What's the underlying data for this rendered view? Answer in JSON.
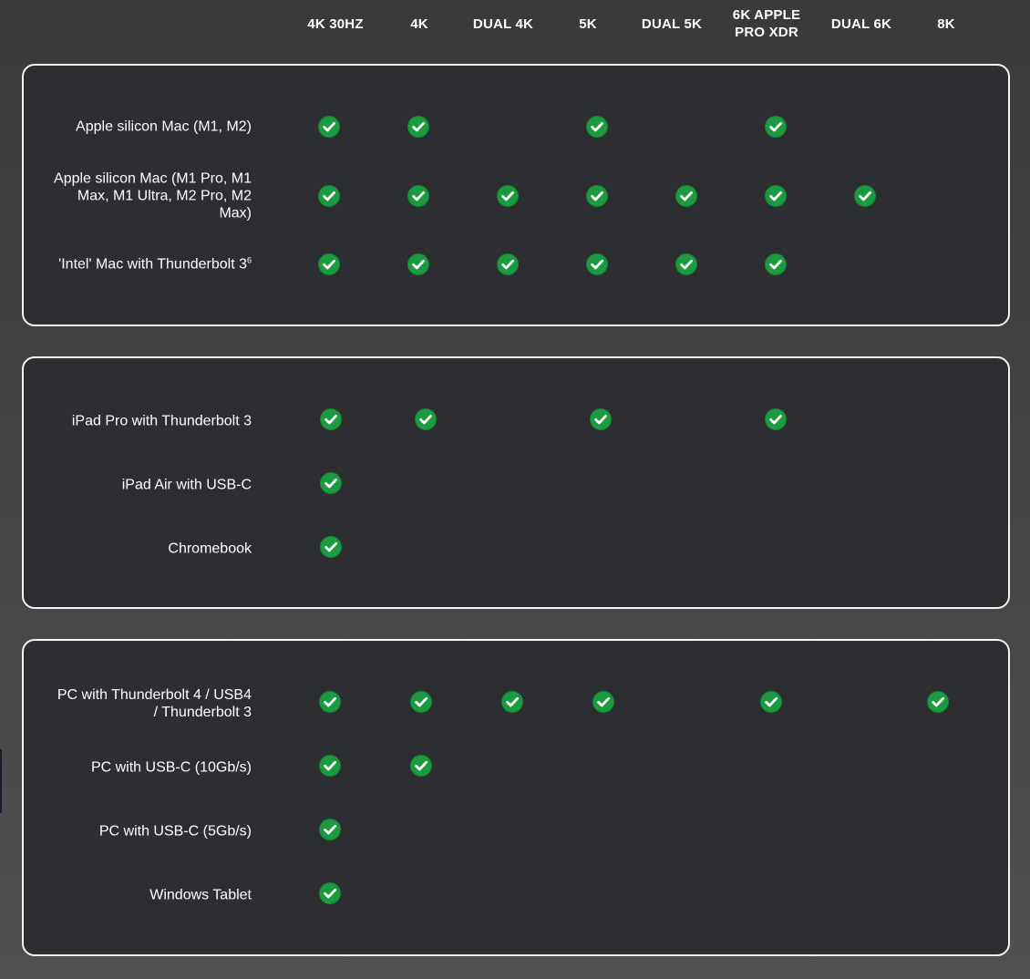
{
  "columns": [
    "4K 30HZ",
    "4K",
    "DUAL 4K",
    "5K",
    "DUAL 5K",
    "6K APPLE\nPRO XDR",
    "DUAL 6K",
    "8K"
  ],
  "groups": [
    {
      "rows": [
        {
          "label": "Apple silicon Mac (M1, M2)",
          "supports": [
            "4K 30HZ",
            "4K",
            "5K",
            "6K APPLE PRO XDR"
          ]
        },
        {
          "label": "Apple silicon Mac (M1 Pro, M1 Max, M1 Ultra, M2 Pro, M2 Max)",
          "supports": [
            "4K 30HZ",
            "4K",
            "DUAL 4K",
            "5K",
            "DUAL 5K",
            "6K APPLE PRO XDR",
            "DUAL 6K"
          ]
        },
        {
          "label": "'Intel' Mac with Thunderbolt 3",
          "footnote": "6",
          "supports": [
            "4K 30HZ",
            "4K",
            "DUAL 4K",
            "5K",
            "DUAL 5K",
            "6K APPLE PRO XDR"
          ]
        }
      ]
    },
    {
      "rows": [
        {
          "label": "iPad Pro with Thunderbolt 3",
          "supports": [
            "4K 30HZ",
            "4K",
            "5K",
            "6K APPLE PRO XDR"
          ]
        },
        {
          "label": "iPad Air with USB-C",
          "supports": [
            "4K 30HZ"
          ]
        },
        {
          "label": "Chromebook",
          "supports": [
            "4K 30HZ"
          ]
        }
      ]
    },
    {
      "rows": [
        {
          "label": "PC with Thunderbolt 4 / USB4\n/ Thunderbolt 3",
          "supports": [
            "4K 30HZ",
            "4K",
            "DUAL 4K",
            "5K",
            "6K APPLE PRO XDR",
            "8K"
          ]
        },
        {
          "label": "PC with USB-C (10Gb/s)",
          "supports": [
            "4K 30HZ",
            "4K"
          ]
        },
        {
          "label": "PC with USB-C (5Gb/s)",
          "supports": [
            "4K 30HZ"
          ]
        },
        {
          "label": "Windows Tablet",
          "supports": [
            "4K 30HZ"
          ]
        }
      ]
    }
  ],
  "icons": {
    "supported": "check-circle-icon"
  },
  "colors": {
    "check": "#1b9a3f",
    "panel": "#2d2e31",
    "border": "#f4f4f4"
  }
}
